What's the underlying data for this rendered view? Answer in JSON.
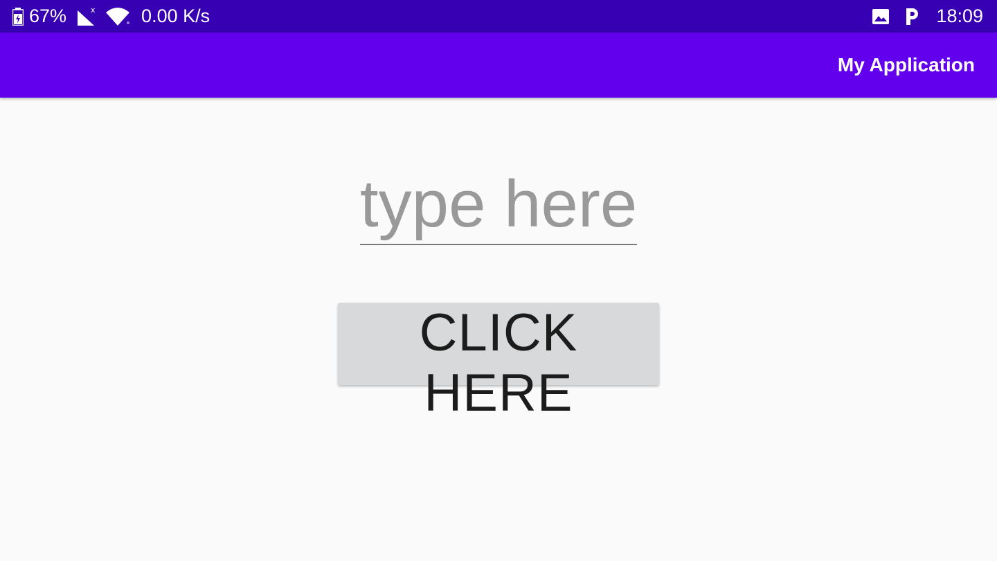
{
  "status_bar": {
    "battery_percent": "67%",
    "network_speed": "0.00 K/s",
    "time": "18:09",
    "icons": [
      "battery-charging-icon",
      "signal-no-data-icon",
      "wifi-icon",
      "image-icon",
      "parking-icon"
    ],
    "background_color": "#3700b3"
  },
  "app_bar": {
    "title": "My Application",
    "background_color": "#6200ee"
  },
  "main": {
    "input": {
      "value": "",
      "placeholder": "type here"
    },
    "button": {
      "label": "CLICK HERE",
      "background_color": "#d8d9da"
    }
  }
}
